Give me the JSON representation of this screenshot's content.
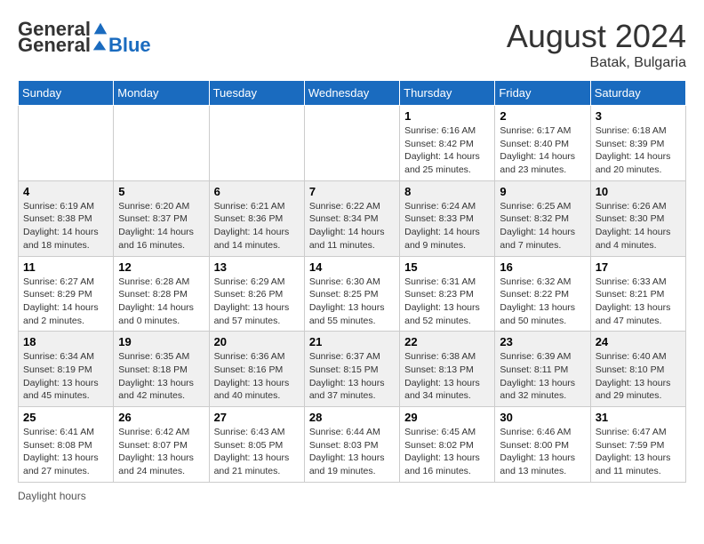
{
  "header": {
    "logo_general": "General",
    "logo_blue": "Blue",
    "month_year": "August 2024",
    "location": "Batak, Bulgaria"
  },
  "days_of_week": [
    "Sunday",
    "Monday",
    "Tuesday",
    "Wednesday",
    "Thursday",
    "Friday",
    "Saturday"
  ],
  "footer": {
    "daylight_label": "Daylight hours"
  },
  "weeks": [
    [
      {
        "day": "",
        "info": ""
      },
      {
        "day": "",
        "info": ""
      },
      {
        "day": "",
        "info": ""
      },
      {
        "day": "",
        "info": ""
      },
      {
        "day": "1",
        "info": "Sunrise: 6:16 AM\nSunset: 8:42 PM\nDaylight: 14 hours and 25 minutes."
      },
      {
        "day": "2",
        "info": "Sunrise: 6:17 AM\nSunset: 8:40 PM\nDaylight: 14 hours and 23 minutes."
      },
      {
        "day": "3",
        "info": "Sunrise: 6:18 AM\nSunset: 8:39 PM\nDaylight: 14 hours and 20 minutes."
      }
    ],
    [
      {
        "day": "4",
        "info": "Sunrise: 6:19 AM\nSunset: 8:38 PM\nDaylight: 14 hours and 18 minutes."
      },
      {
        "day": "5",
        "info": "Sunrise: 6:20 AM\nSunset: 8:37 PM\nDaylight: 14 hours and 16 minutes."
      },
      {
        "day": "6",
        "info": "Sunrise: 6:21 AM\nSunset: 8:36 PM\nDaylight: 14 hours and 14 minutes."
      },
      {
        "day": "7",
        "info": "Sunrise: 6:22 AM\nSunset: 8:34 PM\nDaylight: 14 hours and 11 minutes."
      },
      {
        "day": "8",
        "info": "Sunrise: 6:24 AM\nSunset: 8:33 PM\nDaylight: 14 hours and 9 minutes."
      },
      {
        "day": "9",
        "info": "Sunrise: 6:25 AM\nSunset: 8:32 PM\nDaylight: 14 hours and 7 minutes."
      },
      {
        "day": "10",
        "info": "Sunrise: 6:26 AM\nSunset: 8:30 PM\nDaylight: 14 hours and 4 minutes."
      }
    ],
    [
      {
        "day": "11",
        "info": "Sunrise: 6:27 AM\nSunset: 8:29 PM\nDaylight: 14 hours and 2 minutes."
      },
      {
        "day": "12",
        "info": "Sunrise: 6:28 AM\nSunset: 8:28 PM\nDaylight: 14 hours and 0 minutes."
      },
      {
        "day": "13",
        "info": "Sunrise: 6:29 AM\nSunset: 8:26 PM\nDaylight: 13 hours and 57 minutes."
      },
      {
        "day": "14",
        "info": "Sunrise: 6:30 AM\nSunset: 8:25 PM\nDaylight: 13 hours and 55 minutes."
      },
      {
        "day": "15",
        "info": "Sunrise: 6:31 AM\nSunset: 8:23 PM\nDaylight: 13 hours and 52 minutes."
      },
      {
        "day": "16",
        "info": "Sunrise: 6:32 AM\nSunset: 8:22 PM\nDaylight: 13 hours and 50 minutes."
      },
      {
        "day": "17",
        "info": "Sunrise: 6:33 AM\nSunset: 8:21 PM\nDaylight: 13 hours and 47 minutes."
      }
    ],
    [
      {
        "day": "18",
        "info": "Sunrise: 6:34 AM\nSunset: 8:19 PM\nDaylight: 13 hours and 45 minutes."
      },
      {
        "day": "19",
        "info": "Sunrise: 6:35 AM\nSunset: 8:18 PM\nDaylight: 13 hours and 42 minutes."
      },
      {
        "day": "20",
        "info": "Sunrise: 6:36 AM\nSunset: 8:16 PM\nDaylight: 13 hours and 40 minutes."
      },
      {
        "day": "21",
        "info": "Sunrise: 6:37 AM\nSunset: 8:15 PM\nDaylight: 13 hours and 37 minutes."
      },
      {
        "day": "22",
        "info": "Sunrise: 6:38 AM\nSunset: 8:13 PM\nDaylight: 13 hours and 34 minutes."
      },
      {
        "day": "23",
        "info": "Sunrise: 6:39 AM\nSunset: 8:11 PM\nDaylight: 13 hours and 32 minutes."
      },
      {
        "day": "24",
        "info": "Sunrise: 6:40 AM\nSunset: 8:10 PM\nDaylight: 13 hours and 29 minutes."
      }
    ],
    [
      {
        "day": "25",
        "info": "Sunrise: 6:41 AM\nSunset: 8:08 PM\nDaylight: 13 hours and 27 minutes."
      },
      {
        "day": "26",
        "info": "Sunrise: 6:42 AM\nSunset: 8:07 PM\nDaylight: 13 hours and 24 minutes."
      },
      {
        "day": "27",
        "info": "Sunrise: 6:43 AM\nSunset: 8:05 PM\nDaylight: 13 hours and 21 minutes."
      },
      {
        "day": "28",
        "info": "Sunrise: 6:44 AM\nSunset: 8:03 PM\nDaylight: 13 hours and 19 minutes."
      },
      {
        "day": "29",
        "info": "Sunrise: 6:45 AM\nSunset: 8:02 PM\nDaylight: 13 hours and 16 minutes."
      },
      {
        "day": "30",
        "info": "Sunrise: 6:46 AM\nSunset: 8:00 PM\nDaylight: 13 hours and 13 minutes."
      },
      {
        "day": "31",
        "info": "Sunrise: 6:47 AM\nSunset: 7:59 PM\nDaylight: 13 hours and 11 minutes."
      }
    ]
  ]
}
